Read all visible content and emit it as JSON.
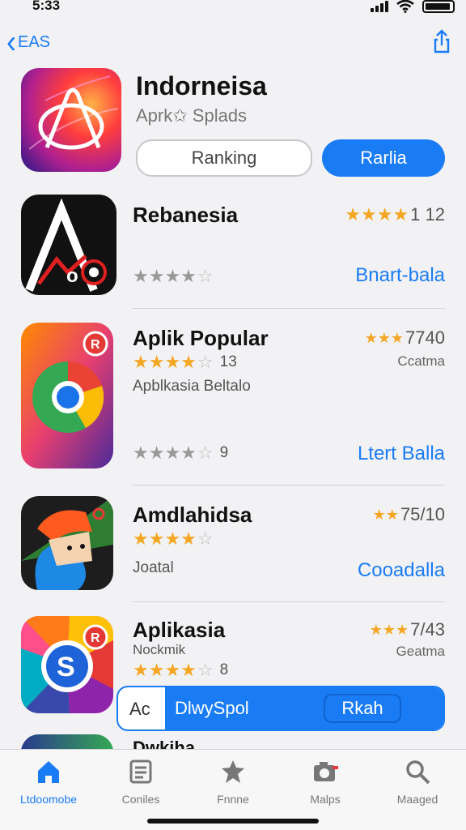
{
  "status": {
    "time": "5:33"
  },
  "nav": {
    "back_label": "EAS"
  },
  "header": {
    "title": "Indorneisa",
    "subtitle": "Aprk✩ Splads",
    "ranking_button": "Ranking",
    "get_button": "Rarlia"
  },
  "apps": [
    {
      "name": "Rebanesia",
      "rating_right": "1 12",
      "right_stars": 4,
      "mid_stars": 4,
      "action": "Bnart-bala"
    },
    {
      "name": "Aplik Popular",
      "rating_right": "7740",
      "right_stars": 3,
      "stars": 4,
      "stars_count": "13",
      "category": "Ccatma",
      "subtitle": "Apblkasia Beltalo",
      "bottom_stars": 4,
      "bottom_count": "9",
      "action": "Ltert Balla"
    },
    {
      "name": "Amdlahidsa",
      "rating_right": "75/10",
      "right_stars": 2,
      "stars": 4,
      "subtitle": "Joatal",
      "action": "Cooadalla"
    },
    {
      "name": "Aplikasia",
      "rating_right": "7/43",
      "right_stars": 3,
      "subtitle": "Nockmik",
      "category": "Geatma",
      "stars": 4,
      "stars_count": "8"
    },
    {
      "name": "Dwkiha"
    }
  ],
  "overlay": {
    "left": "Ac",
    "middle": "DlwySpol",
    "right": "Rkah"
  },
  "tabs": [
    {
      "label": "Ltdoomobe",
      "icon": "home-icon",
      "active": true
    },
    {
      "label": "Coniles",
      "icon": "list-icon",
      "active": false
    },
    {
      "label": "Fnnne",
      "icon": "star-badge-icon",
      "active": false
    },
    {
      "label": "Malps",
      "icon": "camera-icon",
      "active": false
    },
    {
      "label": "Maaged",
      "icon": "search-icon",
      "active": false
    }
  ],
  "colors": {
    "accent": "#1a7cf5",
    "star": "#f5a623"
  }
}
